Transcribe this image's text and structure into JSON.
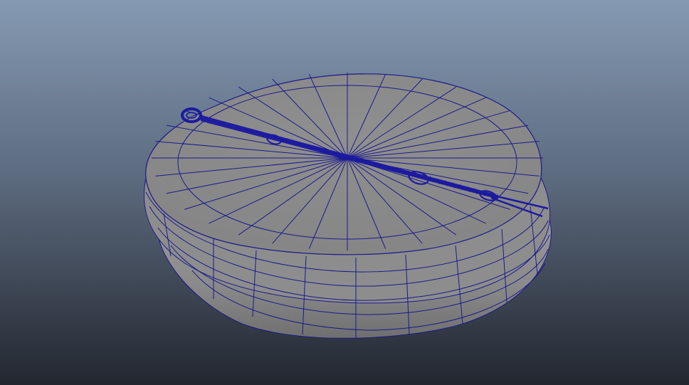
{
  "viewport": {
    "background_top_color": "#8599b2",
    "background_bottom_color": "#232730",
    "mesh_fill_color": "#8b8b8b",
    "mesh_top_fill_color": "#878787",
    "wireframe_color": "#1b1a8c",
    "skewer_color": "#1c1aa0"
  },
  "scene": {
    "objects": [
      {
        "name": "plate-mesh",
        "shading": "smooth-shaded-with-wireframe"
      },
      {
        "name": "skewer-mesh",
        "shading": "wireframe-dense"
      }
    ]
  }
}
